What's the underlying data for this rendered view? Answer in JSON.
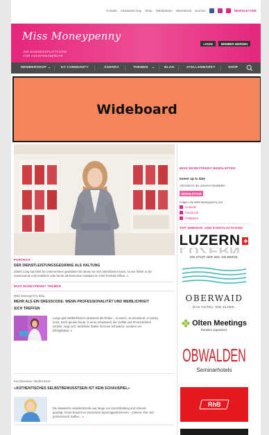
{
  "util_bar": {
    "links": [
      "Kontakt",
      "Assistants Day",
      "Shop",
      "Mediadaten",
      "Warenkorb",
      "Suchen"
    ],
    "newsletter": "NEWSLETTER"
  },
  "brand": {
    "logo": "Miss Moneypenny",
    "tagline_line1": "DIE BUSINESSPLATTFORM",
    "tagline_line2": "FÜR ASSISTENZBERUFE",
    "login": "LOGIN",
    "member": "MEMBER WERDEN",
    "color": "#e6267a"
  },
  "nav": {
    "items": [
      "MEMBERSHOP",
      "EA COMMUNITY",
      "AGENDA",
      "THEMEN",
      "BLOG",
      "STELLENMARKT",
      "SHOP"
    ]
  },
  "wideboard": {
    "label": "Wideboard"
  },
  "hero": {
    "kicker": "PORTRAIT",
    "headline": "DER DIENSTLEISTUNGSGEDANKE ALS HALTUNG",
    "text_line1": "Zabeh Lang hat stets für Unternehmen gearbeitet mit denen sie sich identifizieren kann, so wie früher in der",
    "text_line2": "Gastronomie und Hotellerie oder heute als Executive Assistant im Chef Produkt Officer.",
    "more": "»"
  },
  "section": {
    "kicker": "MISS MONEYPENNY THEMEN"
  },
  "article1": {
    "category": "Miss Moneypenny Blog",
    "headline_line1": "MEHR ALS EIN DRESSCODE: WENN PROFESSIONALITÄT UND WEIBLICHKEIT",
    "headline_line2": "SICH TREFFEN",
    "text_line1": "Lange galt Weiblichkeit im Business als Risiko – zu weich, zu emotional, zu wenig",
    "text_line2": "ernst. Doch gerade heute, in einer Arbeitswelt, die Vielfalt und Persönlichkeit",
    "text_line3": "schätzt, zeigt sich: Weibliche Stärke ist keine Schwäche, sondern ein",
    "text_line4": "Erfolgsfaktor.",
    "more": "»"
  },
  "article2": {
    "category": "Kurzinterview: Sandra Boss",
    "headline": "«AUTHENTISCHES SELBSTBEWUSSTSEIN IST KEIN SCHAUSPIEL»",
    "text_line1": "Die klassische Assistentinrolle war lange von Zurückhaltung und «Dienst-",
    "text_line2": "geprägt. Heute braucht es souveräne Sparringpartnerinnen – präsent, klar und",
    "text_line3": "professionell. Kaffee...",
    "more": "»"
  },
  "sidebar": {
    "newsletter_title": "MISS MONEYPENNY NEWSLETTER",
    "stay_updated": "Immer up to date",
    "subscribe_text": "Abonnieren Sie unseren Newsletter",
    "newsletter_button": "NEWSLETTER",
    "follow_text": "Folgen Sie Miss Moneypenny auf",
    "social": [
      "LinkedIn",
      "Facebook",
      "Instagram"
    ],
    "locations_title": "TOP SEMINAR- UND EVENTLOCATIONS",
    "luzern_name": "LUZERN",
    "luzern_reflect": "LUZERN",
    "luzern_sub": "DIE STADT. DER SEE. DIE BERGE.",
    "oberwaid_name": "OBERWAID",
    "oberwaid_sub": "DAS HOTEL. DIE KLINIK.",
    "olten_name": "Olten Meetings",
    "olten_sub": "Rundum organisiert.",
    "obwalden_name": "OBWALDEN",
    "obwalden_sub": "Seminarhotels",
    "rhb_name": "RhB"
  }
}
